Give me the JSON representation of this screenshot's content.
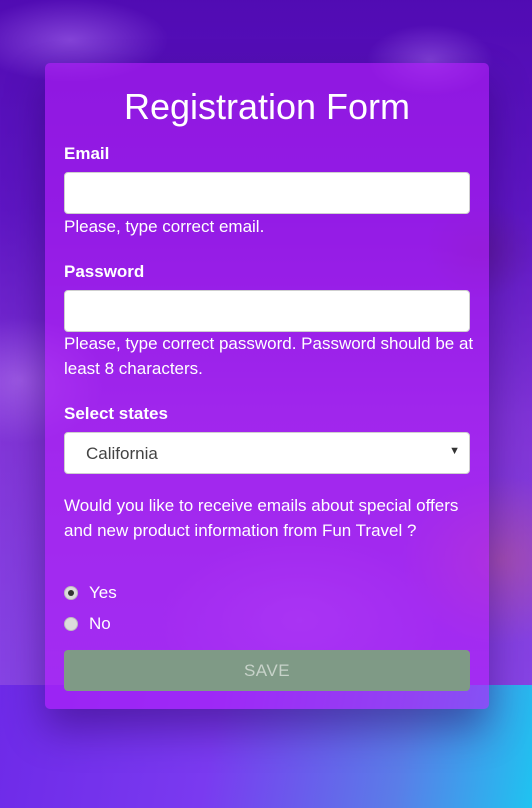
{
  "form": {
    "title": "Registration Form",
    "email": {
      "label": "Email",
      "value": "",
      "placeholder": "",
      "hint": "Please, type correct email."
    },
    "password": {
      "label": "Password",
      "value": "",
      "placeholder": "",
      "hint": "Please, type correct password. Password should be at least 8 characters."
    },
    "states": {
      "label": "Select states",
      "selected": "California"
    },
    "newsletter": {
      "question": "Would you like to receive emails about special offers and new product information from Fun Travel ?",
      "options": [
        {
          "label": "Yes",
          "checked": true
        },
        {
          "label": "No",
          "checked": false
        }
      ]
    },
    "save_label": "SAVE"
  },
  "colors": {
    "card": "#b41efa",
    "save_button": "#7f9a86",
    "accent_cyan": "#1fc3f0"
  }
}
